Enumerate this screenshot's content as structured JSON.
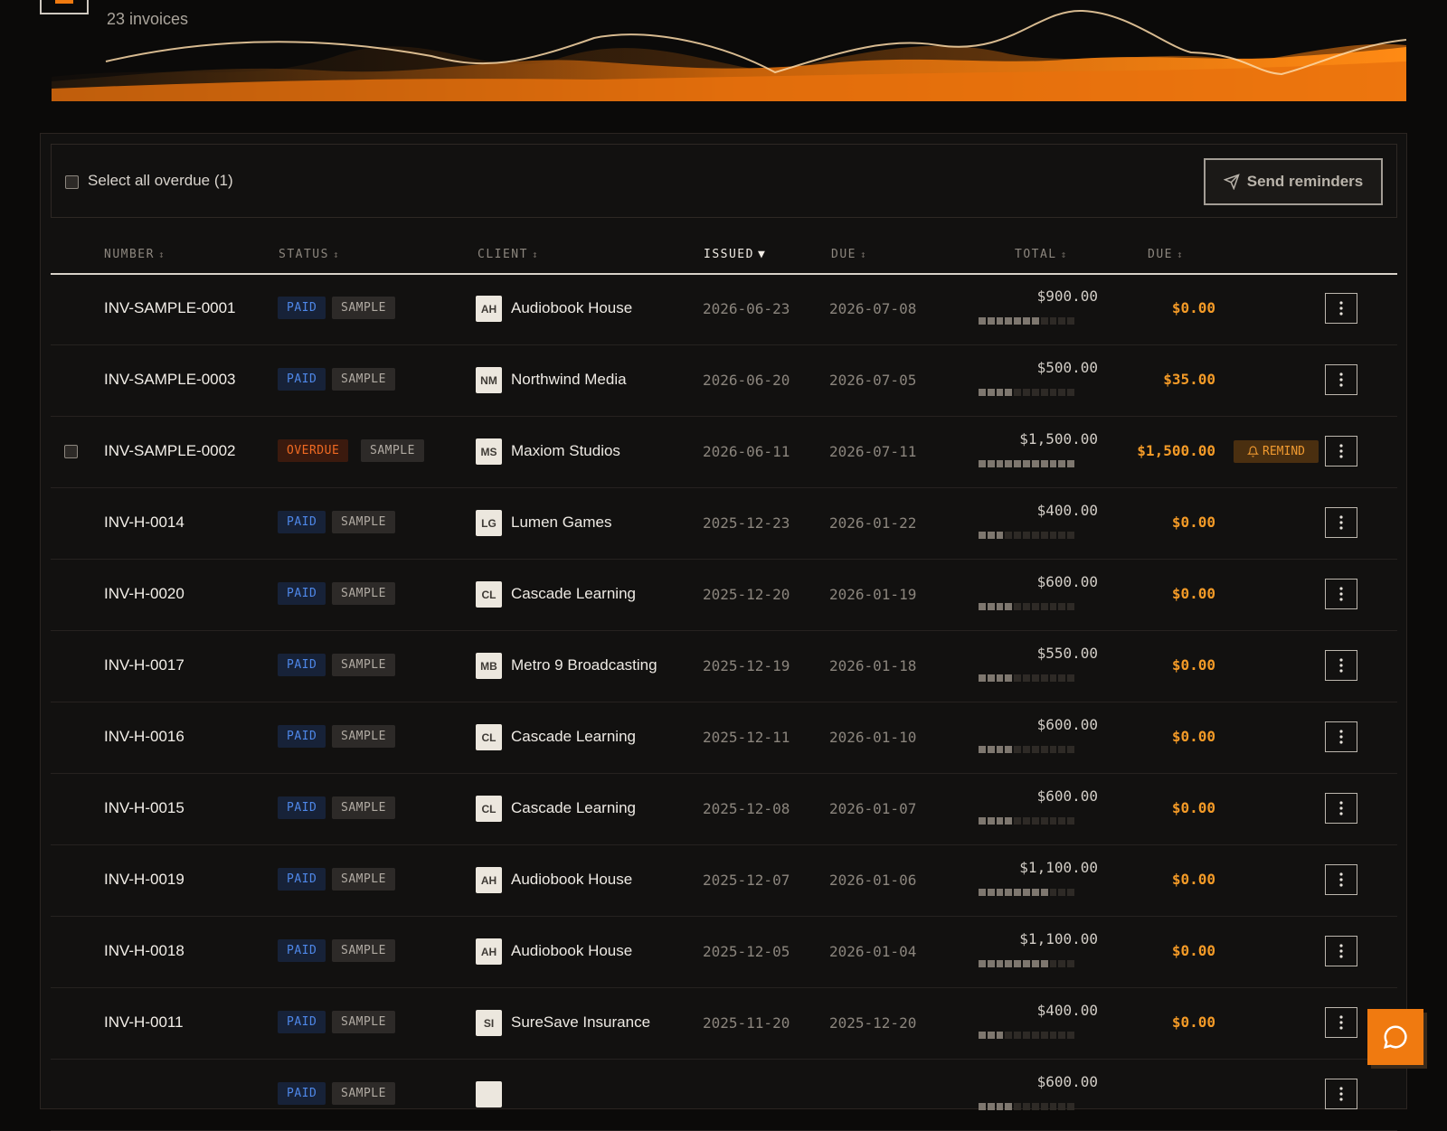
{
  "header": {
    "invoice_count": "23 invoices"
  },
  "toolbar": {
    "select_all_label": "Select all overdue (1)",
    "send_label": "Send reminders"
  },
  "columns": {
    "number": "NUMBER",
    "status": "STATUS",
    "client": "CLIENT",
    "issued": "ISSUED",
    "due_date": "DUE",
    "total": "TOTAL",
    "due_amount": "DUE"
  },
  "colors": {
    "accent": "#f07a10",
    "paid": "#4e87e8",
    "overdue": "#f06a22"
  },
  "invoices": [
    {
      "number": "INV-SAMPLE-0001",
      "status": "PAID",
      "tag": "SAMPLE",
      "initials": "AH",
      "client": "Audiobook House",
      "issued": "2026-06-23",
      "due": "2026-07-08",
      "total": "$900.00",
      "paid_fraction": 0.64,
      "due_amount": "$0.00",
      "checkbox": false,
      "remind": ""
    },
    {
      "number": "INV-SAMPLE-0003",
      "status": "PAID",
      "tag": "SAMPLE",
      "initials": "NM",
      "client": "Northwind Media",
      "issued": "2026-06-20",
      "due": "2026-07-05",
      "total": "$500.00",
      "paid_fraction": 0.36,
      "due_amount": "$35.00",
      "checkbox": false,
      "remind": ""
    },
    {
      "number": "INV-SAMPLE-0002",
      "status": "OVERDUE",
      "tag": "SAMPLE",
      "initials": "MS",
      "client": "Maxiom Studios",
      "issued": "2026-06-11",
      "due": "2026-07-11",
      "total": "$1,500.00",
      "paid_fraction": 1.0,
      "due_amount": "$1,500.00",
      "checkbox": true,
      "remind": "REMIND"
    },
    {
      "number": "INV-H-0014",
      "status": "PAID",
      "tag": "SAMPLE",
      "initials": "LG",
      "client": "Lumen Games",
      "issued": "2025-12-23",
      "due": "2026-01-22",
      "total": "$400.00",
      "paid_fraction": 0.27,
      "due_amount": "$0.00",
      "checkbox": false,
      "remind": ""
    },
    {
      "number": "INV-H-0020",
      "status": "PAID",
      "tag": "SAMPLE",
      "initials": "CL",
      "client": "Cascade Learning",
      "issued": "2025-12-20",
      "due": "2026-01-19",
      "total": "$600.00",
      "paid_fraction": 0.36,
      "due_amount": "$0.00",
      "checkbox": false,
      "remind": ""
    },
    {
      "number": "INV-H-0017",
      "status": "PAID",
      "tag": "SAMPLE",
      "initials": "MB",
      "client": "Metro 9 Broadcasting",
      "issued": "2025-12-19",
      "due": "2026-01-18",
      "total": "$550.00",
      "paid_fraction": 0.36,
      "due_amount": "$0.00",
      "checkbox": false,
      "remind": ""
    },
    {
      "number": "INV-H-0016",
      "status": "PAID",
      "tag": "SAMPLE",
      "initials": "CL",
      "client": "Cascade Learning",
      "issued": "2025-12-11",
      "due": "2026-01-10",
      "total": "$600.00",
      "paid_fraction": 0.36,
      "due_amount": "$0.00",
      "checkbox": false,
      "remind": ""
    },
    {
      "number": "INV-H-0015",
      "status": "PAID",
      "tag": "SAMPLE",
      "initials": "CL",
      "client": "Cascade Learning",
      "issued": "2025-12-08",
      "due": "2026-01-07",
      "total": "$600.00",
      "paid_fraction": 0.36,
      "due_amount": "$0.00",
      "checkbox": false,
      "remind": ""
    },
    {
      "number": "INV-H-0019",
      "status": "PAID",
      "tag": "SAMPLE",
      "initials": "AH",
      "client": "Audiobook House",
      "issued": "2025-12-07",
      "due": "2026-01-06",
      "total": "$1,100.00",
      "paid_fraction": 0.73,
      "due_amount": "$0.00",
      "checkbox": false,
      "remind": ""
    },
    {
      "number": "INV-H-0018",
      "status": "PAID",
      "tag": "SAMPLE",
      "initials": "AH",
      "client": "Audiobook House",
      "issued": "2025-12-05",
      "due": "2026-01-04",
      "total": "$1,100.00",
      "paid_fraction": 0.73,
      "due_amount": "$0.00",
      "checkbox": false,
      "remind": ""
    },
    {
      "number": "INV-H-0011",
      "status": "PAID",
      "tag": "SAMPLE",
      "initials": "SI",
      "client": "SureSave Insurance",
      "issued": "2025-11-20",
      "due": "2025-12-20",
      "total": "$400.00",
      "paid_fraction": 0.27,
      "due_amount": "$0.00",
      "checkbox": false,
      "remind": ""
    },
    {
      "number": "",
      "status": "PAID",
      "tag": "SAMPLE",
      "initials": "",
      "client": "",
      "issued": "",
      "due": "",
      "total": "$600.00",
      "paid_fraction": 0.36,
      "due_amount": "",
      "checkbox": false,
      "remind": ""
    }
  ]
}
